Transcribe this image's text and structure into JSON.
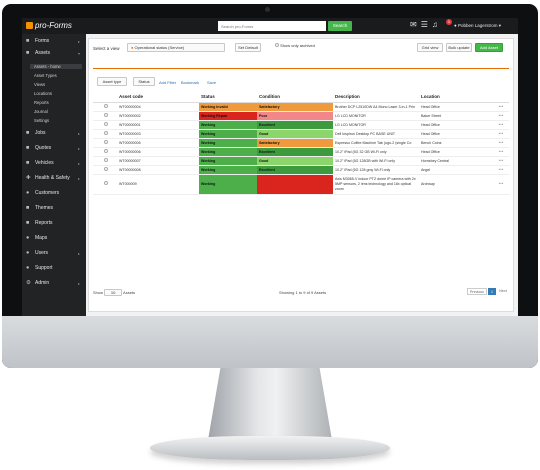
{
  "app": {
    "brand": "pro-Forms"
  },
  "topbar": {
    "search_placeholder": "Search pro-Forms",
    "search_button": "Search",
    "notification_count": "1",
    "user_name": "Pobben Lagerstrom"
  },
  "sidebar": {
    "items": [
      {
        "label": "Forms"
      },
      {
        "label": "Assets"
      },
      {
        "label": "Jobs"
      },
      {
        "label": "Quotes"
      },
      {
        "label": "Vehicles"
      },
      {
        "label": "Health & Safety"
      },
      {
        "label": "Customers"
      },
      {
        "label": "Themes"
      },
      {
        "label": "Reports"
      },
      {
        "label": "Maps"
      },
      {
        "label": "Users"
      },
      {
        "label": "Support"
      },
      {
        "label": "Admin"
      }
    ],
    "sub_items": [
      {
        "label": "Assets - home"
      },
      {
        "label": "Asset Types"
      },
      {
        "label": "Views"
      },
      {
        "label": "Locations"
      },
      {
        "label": "Reports"
      },
      {
        "label": "Journal"
      },
      {
        "label": "Settings"
      }
    ]
  },
  "toolbar": {
    "select_view_label": "Select a view",
    "view_value": "Operational status (Service)",
    "set_default": "Set Default",
    "show_archived": "Show only archived",
    "grid_view": "Grid view",
    "bulk_update": "Bulk update",
    "add_asset": "Add Asset",
    "filter_asset_type": "Asset type",
    "filter_status": "Status",
    "add_filter": "Add Filter",
    "bookmark": "Bookmark",
    "save": "Save"
  },
  "table": {
    "columns": [
      "Asset code",
      "Status",
      "Condition",
      "Description",
      "Location"
    ],
    "rows": [
      {
        "code": "WT00000004",
        "status": "Working Invalid",
        "status_color": "#f09a3e",
        "condition": "Satisfactory",
        "condition_color": "#f09a3e",
        "description": "Brother DCP L2510DW A4 Mono Laser 3-in-1 Prin",
        "location": "Head Office"
      },
      {
        "code": "WT00000002",
        "status": "Working Repair",
        "status_color": "#d9251d",
        "condition": "Poor",
        "condition_color": "#f2878a",
        "description": "LG LCD MONITOR",
        "location": "Baker Street"
      },
      {
        "code": "WT00000001",
        "status": "Working",
        "status_color": "#4caf4a",
        "condition": "Excellent",
        "condition_color": "#3d9a3d",
        "description": "LG LCD MONITOR",
        "location": "Head Office"
      },
      {
        "code": "WT00000003",
        "status": "Working",
        "status_color": "#4caf4a",
        "condition": "Good",
        "condition_color": "#8bd56a",
        "description": "Dell Inspiron Desktop PC BASE UNIT",
        "location": "Head Office"
      },
      {
        "code": "WT00000005",
        "status": "Working",
        "status_color": "#4caf4a",
        "condition": "Satisfactory",
        "condition_color": "#f09a3e",
        "description": "Espresso Coffee Machine Tab (ugo-2 (single Co",
        "location": "Bench Coins"
      },
      {
        "code": "WT00000006",
        "status": "Working",
        "status_color": "#4caf4a",
        "condition": "Excellent",
        "condition_color": "#3d9a3d",
        "description": "10.2\" iPad (5G 32 GB Wi-Fi only",
        "location": "Head Office"
      },
      {
        "code": "WT00000007",
        "status": "Working",
        "status_color": "#4caf4a",
        "condition": "Good",
        "condition_color": "#8bd56a",
        "description": "10.2\" iPad (5G 128GB with Wi-Fi only",
        "location": "Hornsbey Central"
      },
      {
        "code": "WT00000008",
        "status": "Working",
        "status_color": "#4caf4a",
        "condition": "Excellent",
        "condition_color": "#3d9a3d",
        "description": "10.2\" iPad (5G 128 gmy Wi-Fi only",
        "location": "Angel"
      },
      {
        "code": "WT000009",
        "status": "Working",
        "status_color": "#4caf4a",
        "condition": "",
        "condition_color": "#d9251d",
        "description": "Axis M3065-V indoor PTZ dome IP camera with 2x 5MP sensors, 2 lens technology and 18x optical zoom",
        "location": "Archway"
      }
    ]
  },
  "footer": {
    "show_label": "Show",
    "page_size": "10",
    "assets_label": "Assets",
    "summary": "Showing 1 to 9 of 9 Assets",
    "previous": "Previous",
    "page": "1",
    "next": "Next"
  }
}
